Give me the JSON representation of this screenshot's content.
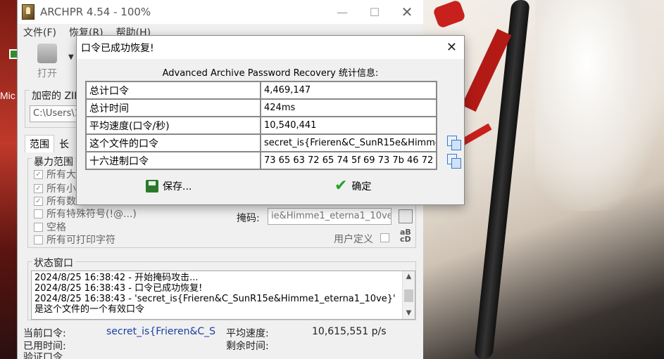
{
  "desktop": {
    "left_text": "Mic"
  },
  "main_window": {
    "title": "ARCHPR 4.54 - 100%",
    "menu": [
      "文件(F)",
      "恢复(R)",
      "帮助(H)"
    ],
    "toolbar": {
      "open_label": "打开"
    },
    "zip_group_label": "加密的 ZIP",
    "zip_path": "C:\\Users\\1",
    "tabs": [
      "范围",
      "长"
    ],
    "brute_group_label": "暴力范围",
    "charset_options": [
      {
        "label": "所有大",
        "checked": true
      },
      {
        "label": "所有小",
        "checked": true
      },
      {
        "label": "所有数",
        "checked": true
      },
      {
        "label": "所有特殊符号(!@...)",
        "checked": false
      },
      {
        "label": "空格",
        "checked": false
      },
      {
        "label": "所有可打印字符",
        "checked": false
      }
    ],
    "mask_label": "掩码:",
    "mask_value": "ie&Himme1_eterna1_10ve}",
    "custom_label": "用户定义",
    "status_group_label": "状态窗口",
    "status_lines": [
      "2024/8/25 16:38:42 - 开始掩码攻击...",
      "2024/8/25 16:38:43 - 口令已成功恢复!",
      "2024/8/25 16:38:43 - 'secret_is{Frieren&C_SunR15e&Himme1_eterna1_10ve}' 是这个文件的一个有效口令"
    ],
    "current_password_label": "当前口令:",
    "current_password_value": "secret_is{Frieren&C_S",
    "avg_speed_label": "平均速度:",
    "avg_speed_value": "10,615,551 p/s",
    "elapsed_label": "已用时间:",
    "remaining_label": "剩余时间:",
    "verify_label": "验证口令..."
  },
  "dialog": {
    "title": "口令已成功恢复!",
    "header": "Advanced Archive Password Recovery 统计信息:",
    "rows": [
      {
        "key": "总计口令",
        "value": "4,469,147"
      },
      {
        "key": "总计时间",
        "value": "424ms"
      },
      {
        "key": "平均速度(口令/秒)",
        "value": "10,540,441"
      },
      {
        "key": "这个文件的口令",
        "value": "secret_is{Frieren&C_SunR15e&Himme1_e"
      },
      {
        "key": "十六进制口令",
        "value": "73 65 63 72 65 74 5f 69 73 7b 46 72 69 6"
      }
    ],
    "save_label": "保存...",
    "ok_label": "确定"
  }
}
